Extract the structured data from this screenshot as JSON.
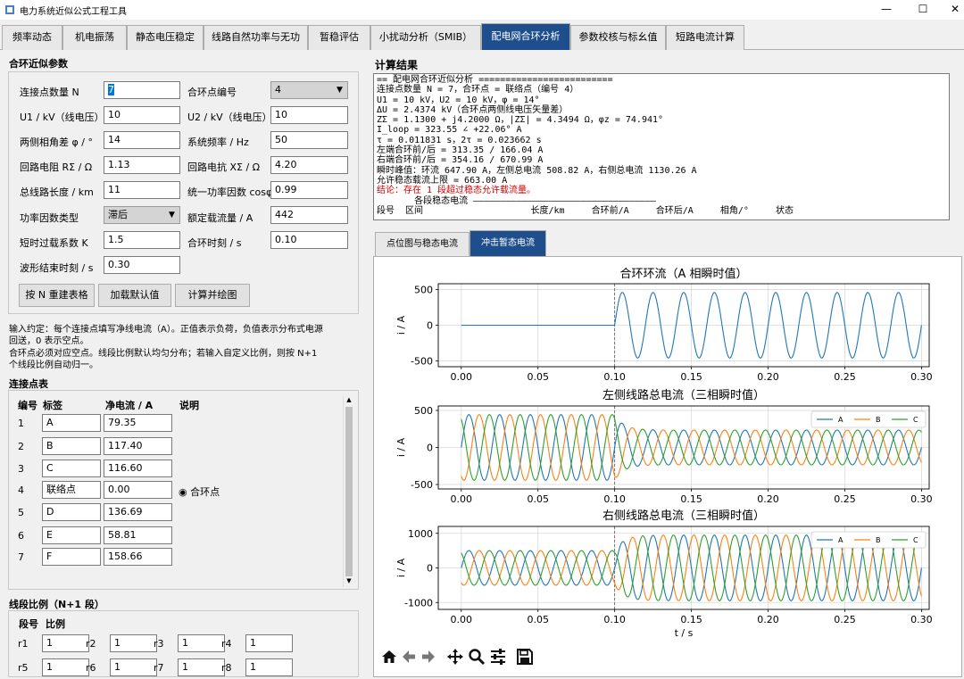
{
  "window": {
    "title": "电力系统近似公式工程工具",
    "minimize_glyph": "—",
    "maximize_glyph": "☐",
    "close_glyph": "✕"
  },
  "tabs": [
    "频率动态",
    "机电振荡",
    "静态电压稳定",
    "线路自然功率与无功",
    "暂稳评估",
    "小扰动分析（SMIB）",
    "配电网合环分析",
    "参数校核与标幺值",
    "短路电流计算"
  ],
  "active_tab": "配电网合环分析",
  "params": {
    "title": "合环近似参数",
    "fields": [
      {
        "label": "连接点数量 N",
        "value": "7"
      },
      {
        "label": "合环点编号",
        "value": "4"
      },
      {
        "label": "U1 / kV（线电压）",
        "value": "10"
      },
      {
        "label": "U2 / kV（线电压）",
        "value": "10"
      },
      {
        "label": "两侧相角差 φ / °",
        "value": "14"
      },
      {
        "label": "系统频率 / Hz",
        "value": "50"
      },
      {
        "label": "回路电阻 RΣ / Ω",
        "value": "1.13"
      },
      {
        "label": "回路电抗 XΣ / Ω",
        "value": "4.20"
      },
      {
        "label": "总线路长度 / km",
        "value": "11"
      },
      {
        "label": "统一功率因数 cosφ",
        "value": "0.99"
      },
      {
        "label": "功率因数类型",
        "value": "滞后"
      },
      {
        "label": "额定载流量 / A",
        "value": "442"
      },
      {
        "label": "短时过载系数 K",
        "value": "1.5"
      },
      {
        "label": "合环时刻 / s",
        "value": "0.10"
      },
      {
        "label": "波形结束时刻 / s",
        "value": "0.30"
      }
    ],
    "buttons": [
      "按 N 重建表格",
      "加载默认值",
      "计算并绘图"
    ]
  },
  "notes": [
    "输入约定：每个连接点填写净线电流（A）。正值表示负荷，负值表示分布式电源",
    "回送，0 表示空点。",
    "合环点必须对应空点。线段比例默认均匀分布；若输入自定义比例，则按 N+1",
    "个线段比例自动归一。"
  ],
  "conn_table": {
    "title": "连接点表",
    "headers": [
      "编号",
      "标签",
      "净电流 / A",
      "说明"
    ],
    "rows": [
      {
        "id": "1",
        "label": "A",
        "current": "79.35",
        "note": ""
      },
      {
        "id": "2",
        "label": "B",
        "current": "117.40",
        "note": ""
      },
      {
        "id": "3",
        "label": "C",
        "current": "116.60",
        "note": ""
      },
      {
        "id": "4",
        "label": "联络点",
        "current": "0.00",
        "note": "◉ 合环点"
      },
      {
        "id": "5",
        "label": "D",
        "current": "136.69",
        "note": ""
      },
      {
        "id": "6",
        "label": "E",
        "current": "58.81",
        "note": ""
      },
      {
        "id": "7",
        "label": "F",
        "current": "158.66",
        "note": ""
      }
    ]
  },
  "ratio_table": {
    "title": "线段比例（N+1 段）",
    "headers": [
      "段号",
      "比例"
    ],
    "cells": [
      {
        "seg": "r1",
        "val": "1"
      },
      {
        "seg": "r2",
        "val": "1"
      },
      {
        "seg": "r3",
        "val": "1"
      },
      {
        "seg": "r4",
        "val": "1"
      },
      {
        "seg": "r5",
        "val": "1"
      },
      {
        "seg": "r6",
        "val": "1"
      },
      {
        "seg": "r7",
        "val": "1"
      },
      {
        "seg": "r8",
        "val": "1"
      }
    ]
  },
  "result": {
    "title": "计算结果",
    "lines": [
      "== 配电网合环近似分析 =========================",
      "连接点数量 N = 7，合环点 = 联络点（编号 4）",
      "U1 = 10 kV，U2 = 10 kV，φ = 14°",
      "ΔU = 2.4374 kV（合环点两侧线电压矢量差）",
      "ZΣ = 1.1300 + j4.2000 Ω，|ZΣ| = 4.3494 Ω，φz = 74.941°",
      "I_loop = 323.55 ∠ +22.06° A",
      "τ = 0.011831 s，2τ = 0.023662 s",
      "左端合环前/后 = 313.35 / 166.04 A",
      "右端合环前/后 = 354.16 / 670.99 A",
      "瞬时峰值：环流 647.90 A，左侧总电流 508.82 A，右侧总电流 1130.26 A",
      "允许稳态载流上限 = 663.00 A",
      "结论：存在 1 段超过稳态允许载流量。",
      "",
      "       各段稳态电流 ——————————————————————————————————",
      "段号  区间                    长度/km     合环前/A     合环后/A     相角/°     状态"
    ],
    "warn_line_index": 11
  },
  "subtabs": [
    "点位图与稳态电流",
    "冲击暂态电流"
  ],
  "active_subtab": "冲击暂态电流",
  "colors": {
    "accent": "#1e4e8c",
    "series_A": "#1f77b4",
    "series_B": "#ff7f0e",
    "series_C": "#2ca02c",
    "warn": "#d00000"
  },
  "toolbar_icons": [
    "home-icon",
    "back-arrow-icon",
    "forward-arrow-icon",
    "pan-icon",
    "zoom-icon",
    "configure-icon",
    "save-icon"
  ],
  "chart_data": [
    {
      "type": "line",
      "title": "合环环流（A 相瞬时值）",
      "ylabel": "i / A",
      "xlabel": "",
      "xlim": [
        -0.015,
        0.305
      ],
      "ylim": [
        -580,
        580
      ],
      "xticks": [
        "0.00",
        "0.05",
        "0.10",
        "0.15",
        "0.20",
        "0.25",
        "0.30"
      ],
      "yticks": [
        "-500",
        "0",
        "500"
      ],
      "grid": true,
      "switch_time": 0.1,
      "series": [
        {
          "key": "loop",
          "amplitude_before": 0,
          "amplitude_after": 457.6,
          "phase_deg": 22.06,
          "dc_offset_peak": 190,
          "tau": 0.011831
        }
      ]
    },
    {
      "type": "line",
      "title": "左侧线路总电流（三相瞬时值）",
      "ylabel": "i / A",
      "xlabel": "",
      "xlim": [
        -0.015,
        0.305
      ],
      "ylim": [
        -560,
        560
      ],
      "xticks": [
        "0.00",
        "0.05",
        "0.10",
        "0.15",
        "0.20",
        "0.25",
        "0.30"
      ],
      "yticks": [
        "-500",
        "0",
        "500"
      ],
      "grid": true,
      "legend": "top-right",
      "switch_time": 0.1,
      "series": [
        {
          "name": "A",
          "amplitude_before": 443,
          "amplitude_after": 235,
          "phase_deg": 0
        },
        {
          "name": "B",
          "amplitude_before": 443,
          "amplitude_after": 235,
          "phase_deg": -120
        },
        {
          "name": "C",
          "amplitude_before": 443,
          "amplitude_after": 235,
          "phase_deg": 120
        }
      ]
    },
    {
      "type": "line",
      "title": "右侧线路总电流（三相瞬时值）",
      "ylabel": "i / A",
      "xlabel": "t / s",
      "xlim": [
        -0.015,
        0.305
      ],
      "ylim": [
        -1200,
        1200
      ],
      "xticks": [
        "0.00",
        "0.05",
        "0.10",
        "0.15",
        "0.20",
        "0.25",
        "0.30"
      ],
      "yticks": [
        "-1000",
        "0",
        "1000"
      ],
      "grid": true,
      "legend": "top-right",
      "switch_time": 0.1,
      "series": [
        {
          "name": "A",
          "amplitude_before": 500,
          "amplitude_after": 949,
          "phase_deg": 0
        },
        {
          "name": "B",
          "amplitude_before": 500,
          "amplitude_after": 949,
          "phase_deg": -120
        },
        {
          "name": "C",
          "amplitude_before": 500,
          "amplitude_after": 949,
          "phase_deg": 120
        }
      ]
    }
  ]
}
